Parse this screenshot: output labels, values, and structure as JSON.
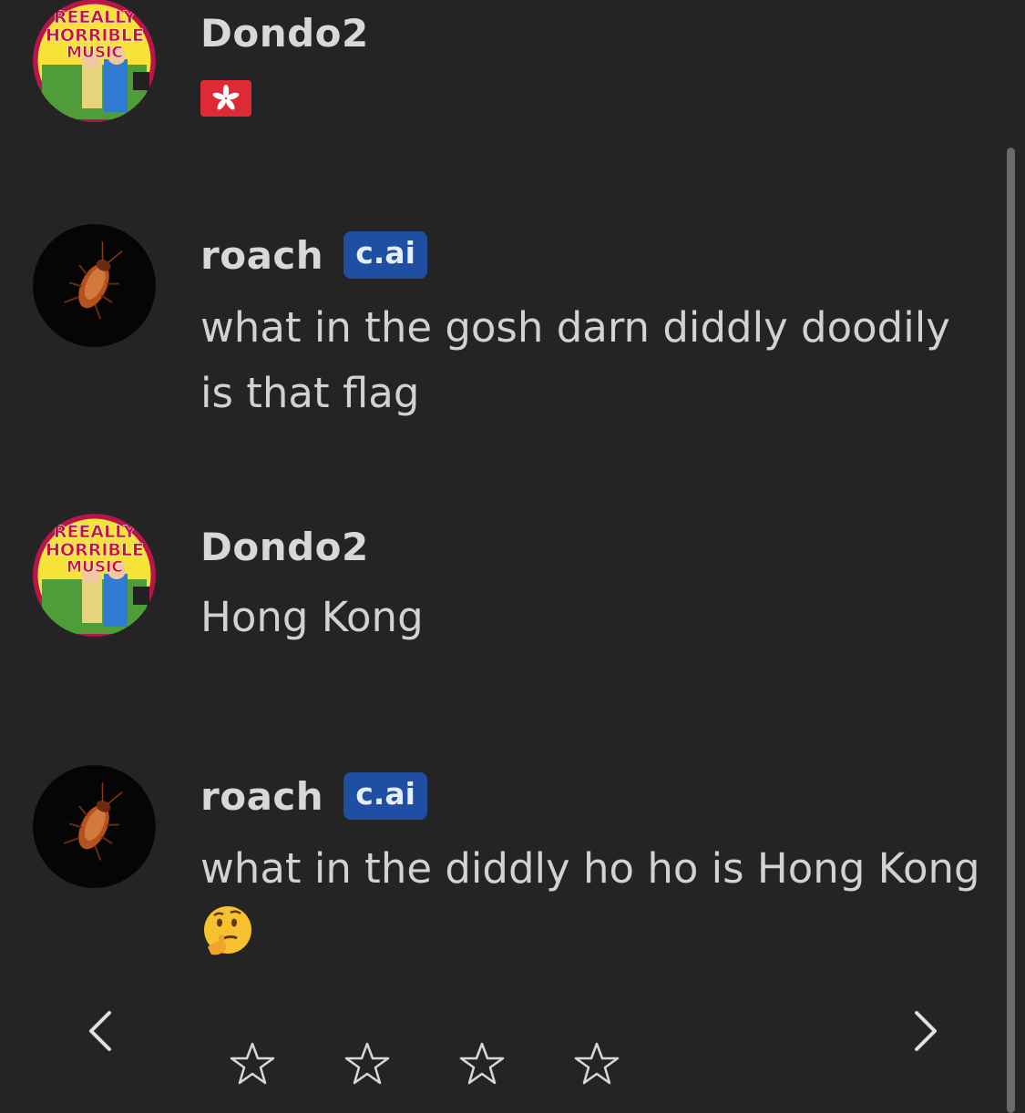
{
  "messages": [
    {
      "author": "Dondo2",
      "avatar": "reeally-horrible-music-avatar",
      "avatar_text": [
        "REEALLY",
        "HORRIBLE",
        "MUSIC"
      ],
      "text": "",
      "emoji": "hong-kong-flag"
    },
    {
      "author": "roach",
      "badge": "c.ai",
      "avatar": "cockroach-avatar",
      "text": "what in the gosh darn diddly doodily is that flag"
    },
    {
      "author": "Dondo2",
      "avatar": "reeally-horrible-music-avatar",
      "avatar_text": [
        "REEALLY",
        "HORRIBLE",
        "MUSIC"
      ],
      "text": "Hong Kong"
    },
    {
      "author": "roach",
      "badge": "c.ai",
      "avatar": "cockroach-avatar",
      "text": "what in the diddly ho ho is Hong Kong",
      "emoji": "thinking-face"
    }
  ],
  "controls": {
    "prev_icon": "chevron-left-icon",
    "next_icon": "chevron-right-icon",
    "rating_max": 5,
    "rating_value": 0
  },
  "colors": {
    "background": "#242424",
    "badge": "#1e4fa3",
    "text": "#d2d2d2"
  }
}
